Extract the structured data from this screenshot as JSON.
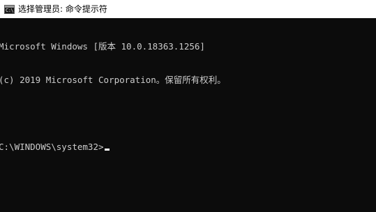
{
  "window": {
    "title": "选择管理员: 命令提示符",
    "icon": "cmd-icon"
  },
  "console": {
    "lines": [
      "Microsoft Windows [版本 10.0.18363.1256]",
      "(c) 2019 Microsoft Corporation。保留所有权利。"
    ],
    "prompt": "C:\\WINDOWS\\system32>"
  },
  "colors": {
    "background": "#0c0c0c",
    "text": "#cccccc",
    "titlebar": "#ffffff"
  }
}
